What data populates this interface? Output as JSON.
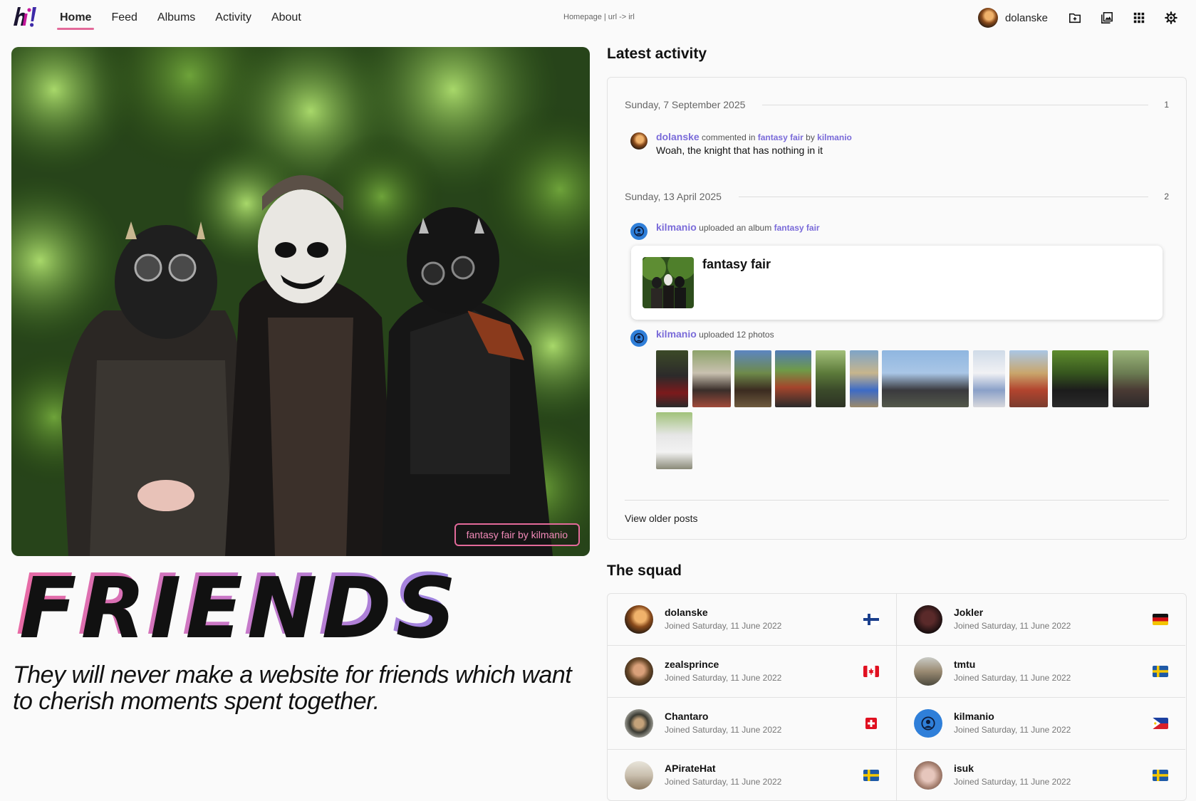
{
  "nav": {
    "items": [
      {
        "label": "Home",
        "active": true
      },
      {
        "label": "Feed"
      },
      {
        "label": "Albums"
      },
      {
        "label": "Activity"
      },
      {
        "label": "About"
      }
    ]
  },
  "breadcrumb": "Homepage | url -> irl",
  "user": {
    "name": "dolanske"
  },
  "toolbar": {
    "icons": [
      "folder-plus-icon",
      "gallery-icon",
      "grid-icon",
      "gear-icon"
    ]
  },
  "hero": {
    "caption": "fantasy fair by kilmanio",
    "title": "FRIENDS",
    "tagline": "They will never make a website for friends which want to cherish moments spent together."
  },
  "activity": {
    "title": "Latest activity",
    "groups": [
      {
        "date": "Sunday, 7 September 2025",
        "count": "1",
        "entries": [
          {
            "user": "dolanske",
            "action": "commented in",
            "target": "fantasy fair",
            "by": "by",
            "owner": "kilmanio",
            "text": "Woah, the knight that has nothing in it"
          }
        ]
      },
      {
        "date": "Sunday, 13 April 2025",
        "count": "2",
        "entries": [
          {
            "user": "kilmanio",
            "action": "uploaded an album",
            "target": "fantasy fair",
            "album_name": "fantasy fair"
          },
          {
            "user": "kilmanio",
            "action": "uploaded 12 photos"
          }
        ]
      }
    ],
    "older_label": "View older posts"
  },
  "squad": {
    "title": "The squad",
    "members": [
      {
        "name": "dolanske",
        "joined": "Joined Saturday, 11 June 2022",
        "flag": "finland"
      },
      {
        "name": "Jokler",
        "joined": "Joined Saturday, 11 June 2022",
        "flag": "germany"
      },
      {
        "name": "zealsprince",
        "joined": "Joined Saturday, 11 June 2022",
        "flag": "canada"
      },
      {
        "name": "tmtu",
        "joined": "Joined Saturday, 11 June 2022",
        "flag": "sweden"
      },
      {
        "name": "Chantaro",
        "joined": "Joined Saturday, 11 June 2022",
        "flag": "switzerland"
      },
      {
        "name": "kilmanio",
        "joined": "Joined Saturday, 11 June 2022",
        "flag": "philippines"
      },
      {
        "name": "APirateHat",
        "joined": "Joined Saturday, 11 June 2022",
        "flag": "sweden"
      },
      {
        "name": "isuk",
        "joined": "Joined Saturday, 11 June 2022",
        "flag": "sweden"
      }
    ]
  },
  "colors": {
    "accent": "#e36a9a",
    "link": "#7a6bd9",
    "avatar_blue": "#2f7fd9"
  }
}
